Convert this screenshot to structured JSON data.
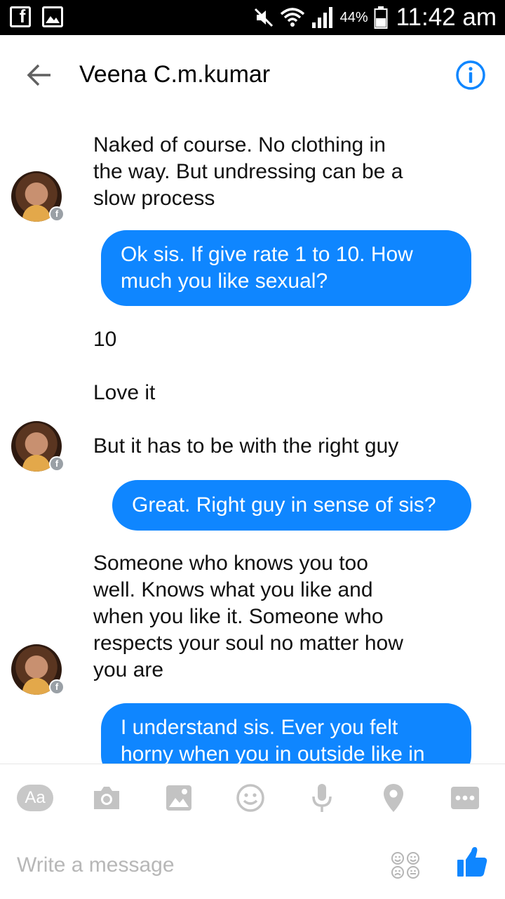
{
  "status_bar": {
    "battery": "44%",
    "time": "11:42 am",
    "icons": [
      "facebook-icon",
      "gallery-icon",
      "mute-icon",
      "wifi-icon",
      "signal-icon",
      "battery-icon"
    ]
  },
  "header": {
    "contact_name": "Veena C.m.kumar",
    "icons": [
      "back-arrow-icon",
      "info-icon"
    ]
  },
  "messages": [
    {
      "from": "contact",
      "lines": [
        "Naked of course. No clothing in",
        "the way. But undressing can be a",
        "slow process"
      ]
    },
    {
      "from": "me",
      "lines": [
        "Ok sis. If give rate 1 to 10. How",
        "much you like sexual?"
      ]
    },
    {
      "from": "contact",
      "lines": [
        "10"
      ]
    },
    {
      "from": "contact",
      "lines": [
        "Love it"
      ]
    },
    {
      "from": "contact",
      "lines": [
        "But it has to be with the right guy"
      ]
    },
    {
      "from": "me",
      "lines": [
        "Great. Right guy in sense of sis?"
      ]
    },
    {
      "from": "contact",
      "lines": [
        "Someone who knows you too",
        "well. Knows what you like and",
        "when you like it. Someone who",
        "respects your soul no matter how",
        "you are"
      ]
    },
    {
      "from": "me",
      "lines": [
        "I understand sis. Ever you felt",
        "horny when you in outside like in"
      ]
    }
  ],
  "composer": {
    "aa_label": "Aa",
    "placeholder": "Write a message",
    "tools": [
      "text-format-icon",
      "camera-icon",
      "image-icon",
      "emoji-icon",
      "microphone-icon",
      "location-icon",
      "more-icon"
    ],
    "accent_color": "#0f86ff",
    "icon_gray": "#c3c3c3"
  }
}
